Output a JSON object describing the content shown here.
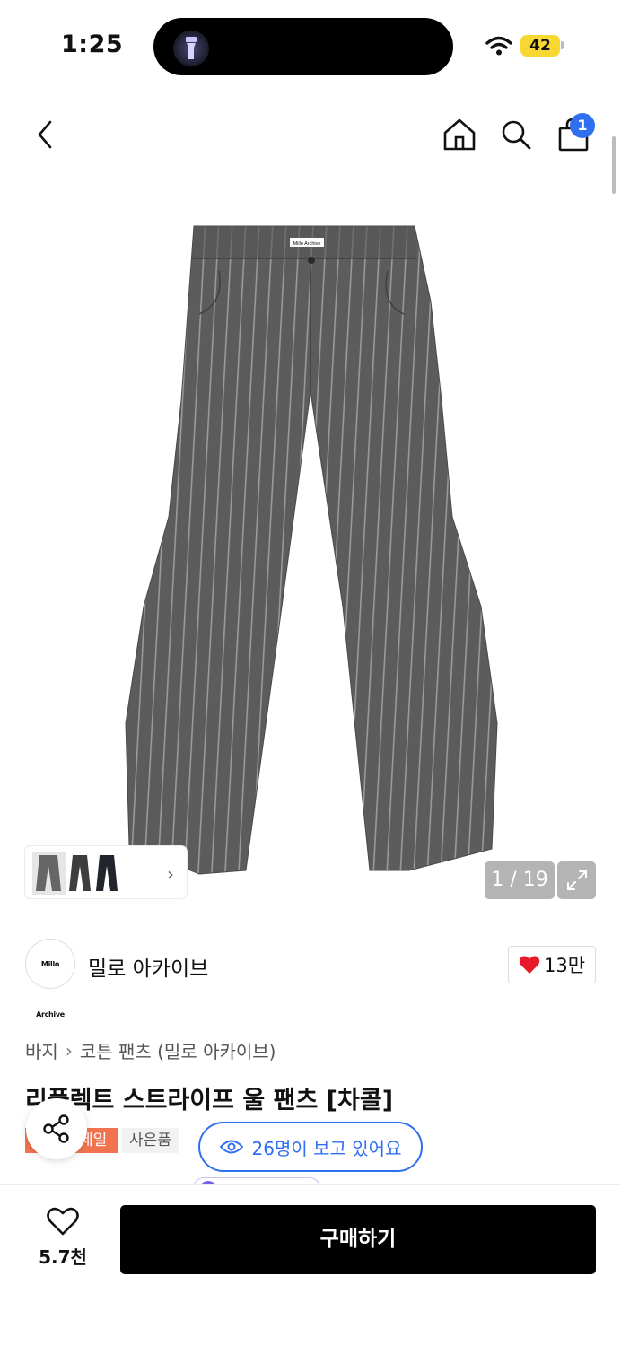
{
  "status_bar": {
    "time": "1:25",
    "battery": "42"
  },
  "nav": {
    "cart_count": "1"
  },
  "gallery": {
    "brand_tag_text": "Millo Archive",
    "counter": "1 / 19"
  },
  "brand": {
    "logo_text": "Millo Archive",
    "name": "밀로 아카이브",
    "likes": "13만"
  },
  "breadcrumb": {
    "category": "바지",
    "subcategory": "코튼 팬츠 (밀로 아카이브)"
  },
  "product": {
    "title": "리플렉트 스트라이프 울 팬츠 [차콜]"
  },
  "tags": {
    "sale": "세일",
    "gift": "사은품"
  },
  "viewers": {
    "text": "26명이 보고 있어요"
  },
  "bottom_bar": {
    "wish_count": "5.7천",
    "buy_label": "구매하기"
  },
  "colors": {
    "accent_blue": "#2f6ff0",
    "sale_orange": "#f2744f",
    "heart_red": "#e8192c"
  }
}
